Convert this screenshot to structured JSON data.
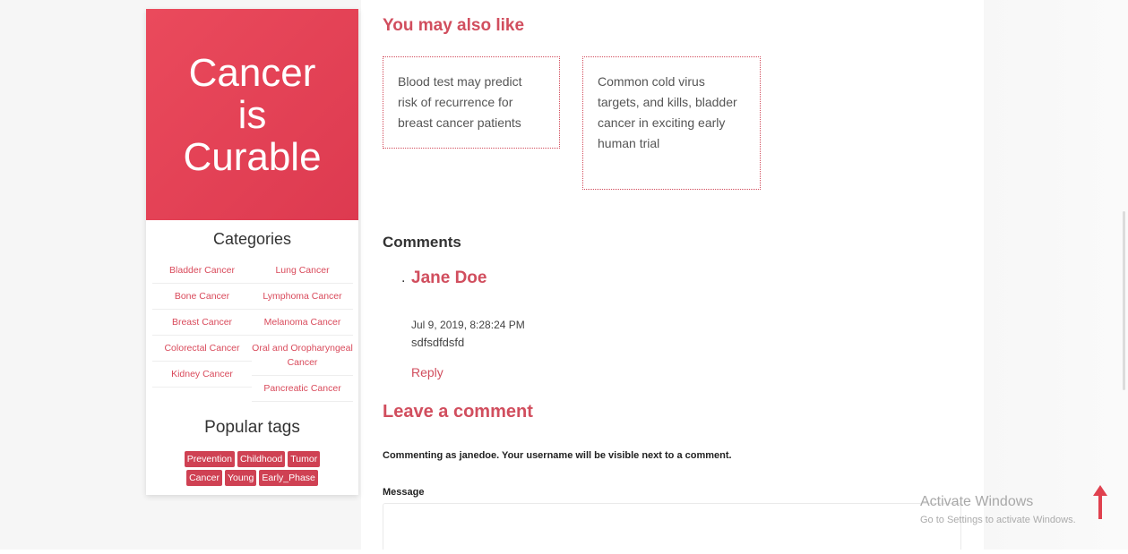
{
  "sidebar": {
    "hero_lines": [
      "Cancer",
      "is",
      "Curable"
    ],
    "categories_title": "Categories",
    "categories_left": [
      "Bladder Cancer",
      "Bone Cancer",
      "Breast Cancer",
      "Colorectal Cancer",
      "Kidney Cancer"
    ],
    "categories_right": [
      "Lung Cancer",
      "Lymphoma Cancer",
      "Melanoma Cancer",
      "Oral and Oropharyngeal Cancer",
      "Pancreatic Cancer"
    ],
    "tags_title": "Popular tags",
    "tags": [
      "Prevention",
      "Childhood",
      "Tumor",
      "Cancer",
      "Young",
      "Early_Phase"
    ]
  },
  "main": {
    "like_title": "You may also like",
    "related": [
      "Blood test may predict risk of recurrence for breast cancer patients",
      "Common cold virus targets, and kills, bladder cancer in exciting early human trial"
    ],
    "comments_title": "Comments",
    "comment": {
      "bullet": ".",
      "author": "Jane Doe",
      "date": "Jul 9, 2019, 8:28:24 PM",
      "body": "sdfsdfdsfd",
      "reply_label": "Reply"
    },
    "leave_title": "Leave a comment",
    "commenting_note": "Commenting as janedoe. Your username will be visible next to a comment.",
    "message_label": "Message"
  },
  "watermark": {
    "title": "Activate Windows",
    "subtitle": "Go to Settings to activate Windows."
  },
  "colors": {
    "accent": "#d14e5e",
    "hero": "#e44458",
    "tag": "#cf4153"
  }
}
